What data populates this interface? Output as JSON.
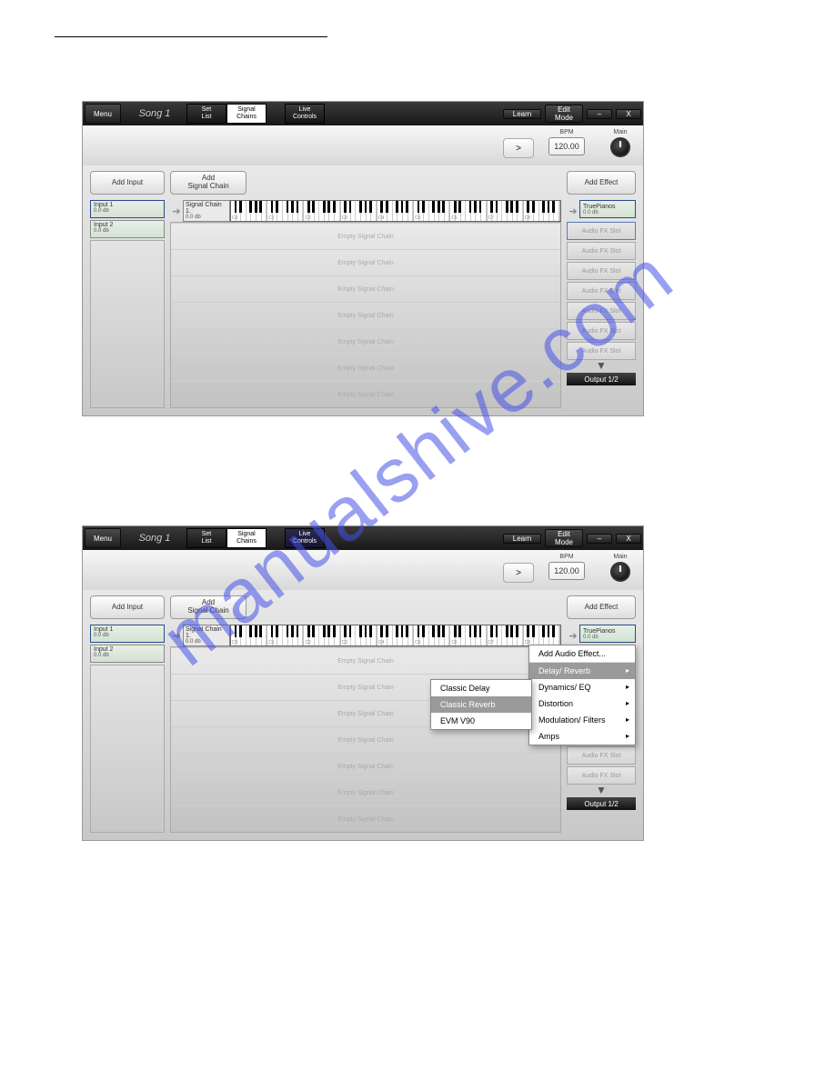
{
  "watermark": "manualshive.com",
  "app": {
    "menu": "Menu",
    "song": "Song 1",
    "tabs": {
      "setlist": "Set\nList",
      "signal": "Signal\nChains",
      "live": "Live\nControls"
    },
    "learn": "Learn",
    "editmode": "Edit\nMode",
    "minimize": "–",
    "close": "X",
    "play": ">",
    "bpm_label": "BPM",
    "bpm": "120.00",
    "main_label": "Main"
  },
  "cols": {
    "add_input": "Add Input",
    "add_chain": "Add\nSignal Chain",
    "add_effect": "Add Effect",
    "inputs": [
      {
        "name": "Input 1",
        "sub": "0.0 db"
      },
      {
        "name": "Input 2",
        "sub": "0.0 db"
      }
    ],
    "chain": {
      "name": "Signal Chain 1.",
      "sub": "0.0 db"
    },
    "oct_labels": [
      "C0",
      "C1",
      "C2",
      "C3",
      "C4",
      "C5",
      "C6",
      "C7",
      "C8"
    ],
    "empty": "Empty Signal Chain",
    "true_pianos": {
      "name": "TruePianos",
      "sub": "0.0 db"
    },
    "fx_slot": "Audio FX Slot",
    "output": "Output 1/2"
  },
  "ctx_main": {
    "header": "Add Audio Effect...",
    "items": [
      "Delay/ Reverb",
      "Dynamics/ EQ",
      "Distortion",
      "Modulation/ Filters",
      "Amps"
    ],
    "hi_index": 0
  },
  "ctx_sub": {
    "items": [
      "Classic Delay",
      "Classic Reverb",
      "EVM V90"
    ],
    "hi_index": 1
  }
}
